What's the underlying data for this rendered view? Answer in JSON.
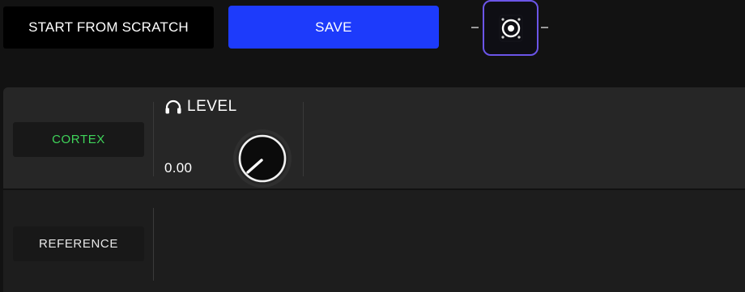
{
  "toolbar": {
    "start_from_scratch_label": "START FROM SCRATCH",
    "save_label": "SAVE",
    "speaker_icon": "speaker-icon"
  },
  "channels": [
    {
      "label": "CORTEX",
      "label_color": "#3fd45a",
      "level": {
        "icon": "headphones-icon",
        "title": "LEVEL",
        "value": "0.00"
      }
    },
    {
      "label": "REFERENCE",
      "label_color": "#e8e8e8"
    }
  ],
  "colors": {
    "save_button": "#1d3bfb",
    "speaker_border": "#6b55e8",
    "active_channel": "#3fd45a"
  }
}
